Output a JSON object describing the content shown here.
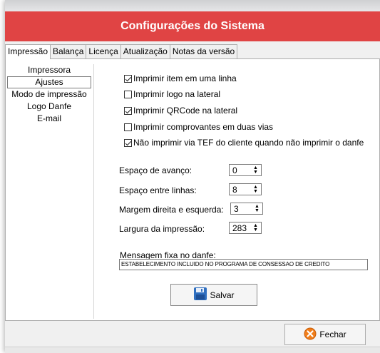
{
  "window": {
    "title": "Configurações do Sistema"
  },
  "tabs": [
    {
      "label": "Impressão",
      "active": true
    },
    {
      "label": "Balança",
      "active": false
    },
    {
      "label": "Licença",
      "active": false
    },
    {
      "label": "Atualização",
      "active": false
    },
    {
      "label": "Notas da versão",
      "active": false
    }
  ],
  "sidebar": {
    "items": [
      {
        "label": "Impressora",
        "active": false
      },
      {
        "label": "Ajustes",
        "active": true
      },
      {
        "label": "Modo de impressão",
        "active": false
      },
      {
        "label": "Logo Danfe",
        "active": false
      },
      {
        "label": "E-mail",
        "active": false
      }
    ]
  },
  "options": [
    {
      "label": "Imprimir item em uma linha",
      "checked": true
    },
    {
      "label": "Imprimir logo na lateral",
      "checked": false
    },
    {
      "label": "Imprimir QRCode na lateral",
      "checked": true
    },
    {
      "label": "Imprimir comprovantes em duas vias",
      "checked": false
    },
    {
      "label": "Não imprimir via TEF do cliente quando não imprimir o danfe",
      "checked": true
    }
  ],
  "fields": [
    {
      "label": "Espaço de avanço:",
      "value": "0"
    },
    {
      "label": "Espaço entre linhas:",
      "value": "8"
    },
    {
      "label": "Margem direita e esquerda:",
      "value": "3"
    },
    {
      "label": "Largura da impressão:",
      "value": "283"
    }
  ],
  "message": {
    "label": "Mensagem fixa no danfe:",
    "value": "ESTABELECIMENTO INCLUIDO NO PROGRAMA DE CONSESSAO DE CREDITO"
  },
  "buttons": {
    "save": "Salvar",
    "close": "Fechar"
  },
  "colors": {
    "header_bg": "#e04444",
    "save_icon": "#2f6fc0",
    "close_icon": "#f07d1a"
  }
}
